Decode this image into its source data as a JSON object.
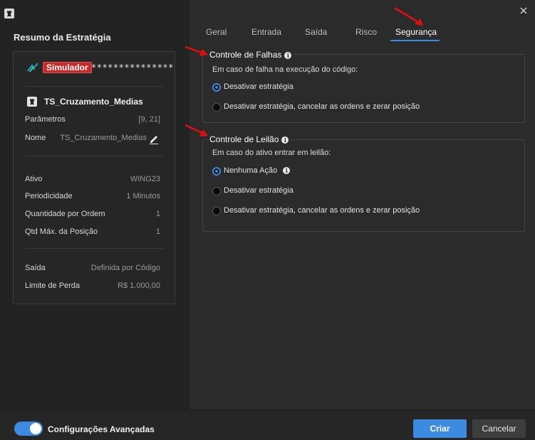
{
  "summary": {
    "title": "Resumo da Estratégia",
    "account": {
      "badge": "Simulador",
      "masked_id": "****************"
    },
    "strategy_name": "TS_Cruzamento_Medias",
    "rows_top": [
      {
        "label": "Parâmetros",
        "value": "[9, 21]"
      },
      {
        "label": "Nome",
        "value": "TS_Cruzamento_Medias"
      }
    ],
    "rows_mid": [
      {
        "label": "Ativo",
        "value": "WING23"
      },
      {
        "label": "Periodicidade",
        "value": "1 Minutos"
      },
      {
        "label": "Quantidade por Ordem",
        "value": "1"
      },
      {
        "label": "Qtd Máx. da Posição",
        "value": "1"
      }
    ],
    "rows_bot": [
      {
        "label": "Saída",
        "value": "Definida por Código"
      },
      {
        "label": "Limite de Perda",
        "value": "R$ 1.000,00"
      }
    ]
  },
  "tabs": [
    {
      "label": "Geral"
    },
    {
      "label": "Entrada"
    },
    {
      "label": "Saída"
    },
    {
      "label": "Risco"
    },
    {
      "label": "Segurança",
      "active": true
    }
  ],
  "falhas": {
    "title": "Controle de Falhas",
    "description": "Em caso de falha na execução do código:",
    "options": [
      {
        "label": "Desativar estratégia",
        "checked": true
      },
      {
        "label": "Desativar estratégia, cancelar as ordens e zerar posição",
        "checked": false
      }
    ]
  },
  "leilao": {
    "title": "Controle de Leilão",
    "description": "Em caso do ativo entrar em leilão:",
    "options": [
      {
        "label": "Nenhuma Ação",
        "checked": true,
        "info": true
      },
      {
        "label": "Desativar estratégia",
        "checked": false
      },
      {
        "label": "Desativar estratégia, cancelar as ordens e zerar posição",
        "checked": false
      }
    ]
  },
  "footer": {
    "toggle_label": "Configurações Avançadas",
    "toggle_on": true,
    "create_label": "Criar",
    "cancel_label": "Cancelar"
  },
  "colors": {
    "accent": "#3d8be0",
    "badge_red": "#c82a2a",
    "annotation_arrow": "#e01010"
  },
  "icons": [
    "app-logo-icon",
    "strategy-logo-icon",
    "chess-rook-icon",
    "pencil-icon",
    "info-icon",
    "close-icon"
  ]
}
